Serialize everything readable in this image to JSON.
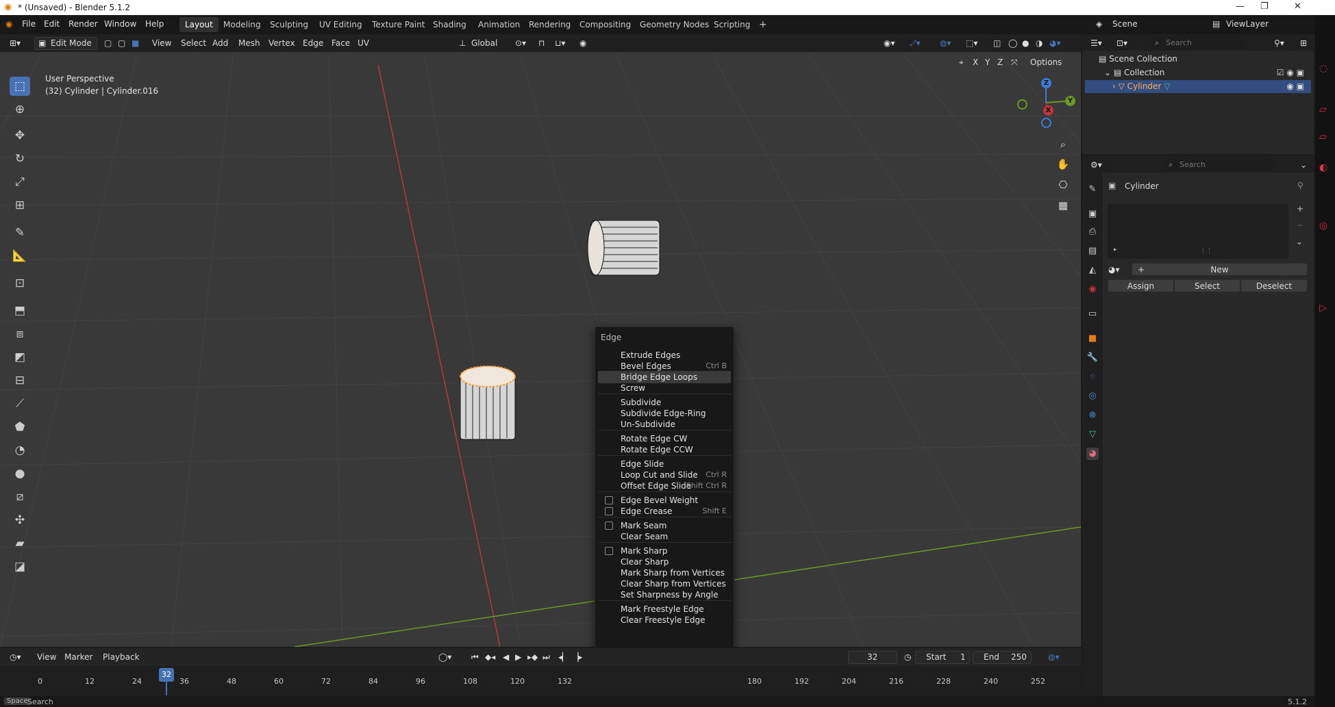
{
  "window": {
    "title": "* (Unsaved) - Blender 5.1.2",
    "controls": [
      "—",
      "❐",
      "✕"
    ]
  },
  "menu": [
    "File",
    "Edit",
    "Render",
    "Window",
    "Help"
  ],
  "workspaces": [
    "Layout",
    "Modeling",
    "Sculpting",
    "UV Editing",
    "Texture Paint",
    "Shading",
    "Animation",
    "Rendering",
    "Compositing",
    "Geometry Nodes",
    "Scripting"
  ],
  "active_workspace": "Layout",
  "scene": {
    "name": "Scene",
    "view_layer": "ViewLayer"
  },
  "viewport": {
    "mode": "Edit Mode",
    "menus": [
      "View",
      "Select",
      "Add",
      "Mesh",
      "Vertex",
      "Edge",
      "Face",
      "UV"
    ],
    "orientation": "Global",
    "options_label": "Options",
    "axes": [
      "X",
      "Y",
      "Z"
    ],
    "info_line1": "User Perspective",
    "info_line2": "(32) Cylinder | Cylinder.016",
    "gizmo": {
      "x": "X",
      "y": "Y",
      "z": "Z"
    }
  },
  "tools": [
    "select-box",
    "cursor",
    "move",
    "rotate",
    "scale",
    "transform",
    "annotate",
    "measure",
    "add-cube",
    "extrude",
    "inset",
    "bevel",
    "loop-cut",
    "knife",
    "poly-build",
    "spin",
    "smooth",
    "edge-slide",
    "shrink-fatten",
    "shear",
    "rip"
  ],
  "context_menu": {
    "title": "Edge",
    "groups": [
      [
        {
          "label": "Extrude Edges",
          "shortcut": ""
        },
        {
          "label": "Bevel Edges",
          "shortcut": "Ctrl B"
        },
        {
          "label": "Bridge Edge Loops",
          "shortcut": "",
          "highlight": true
        },
        {
          "label": "Screw",
          "shortcut": ""
        }
      ],
      [
        {
          "label": "Subdivide",
          "shortcut": ""
        },
        {
          "label": "Subdivide Edge-Ring",
          "shortcut": ""
        },
        {
          "label": "Un-Subdivide",
          "shortcut": ""
        }
      ],
      [
        {
          "label": "Rotate Edge CW",
          "shortcut": ""
        },
        {
          "label": "Rotate Edge CCW",
          "shortcut": ""
        }
      ],
      [
        {
          "label": "Edge Slide",
          "shortcut": ""
        },
        {
          "label": "Loop Cut and Slide",
          "shortcut": "Ctrl R"
        },
        {
          "label": "Offset Edge Slide",
          "shortcut": "Shift Ctrl R"
        }
      ],
      [
        {
          "label": "Edge Bevel Weight",
          "shortcut": "",
          "icon": true
        },
        {
          "label": "Edge Crease",
          "shortcut": "Shift E",
          "icon": true
        }
      ],
      [
        {
          "label": "Mark Seam",
          "shortcut": "",
          "icon": true
        },
        {
          "label": "Clear Seam",
          "shortcut": ""
        }
      ],
      [
        {
          "label": "Mark Sharp",
          "shortcut": "",
          "icon": true
        },
        {
          "label": "Clear Sharp",
          "shortcut": ""
        },
        {
          "label": "Mark Sharp from Vertices",
          "shortcut": ""
        },
        {
          "label": "Clear Sharp from Vertices",
          "shortcut": ""
        },
        {
          "label": "Set Sharpness by Angle",
          "shortcut": ""
        }
      ],
      [
        {
          "label": "Mark Freestyle Edge",
          "shortcut": ""
        },
        {
          "label": "Clear Freestyle Edge",
          "shortcut": ""
        }
      ]
    ]
  },
  "timeline": {
    "menus": [
      "View",
      "Marker",
      "Playback"
    ],
    "current_frame": "32",
    "start_label": "Start",
    "start": "1",
    "end_label": "End",
    "end": "250",
    "ticks": [
      "0",
      "12",
      "24",
      "36",
      "48",
      "60",
      "72",
      "84",
      "96",
      "108",
      "120",
      "132",
      "180",
      "192",
      "204",
      "216",
      "228",
      "240",
      "252"
    ]
  },
  "outliner": {
    "search_placeholder": "Search",
    "rows": [
      "Scene Collection",
      "Collection",
      "Cylinder"
    ]
  },
  "properties": {
    "search_placeholder": "Search",
    "object": "Cylinder",
    "new_label": "New",
    "assign_label": "Assign",
    "select_label": "Select",
    "deselect_label": "Deselect"
  },
  "statusbar": {
    "key": "Space",
    "action": "Search",
    "version": "5.1.2"
  },
  "colors": {
    "accent": "#4772b3",
    "selected_text": "#ffb05a",
    "viewport_bg": "#393939",
    "x_axis": "#c0343c",
    "y_axis": "#6a9a24"
  }
}
